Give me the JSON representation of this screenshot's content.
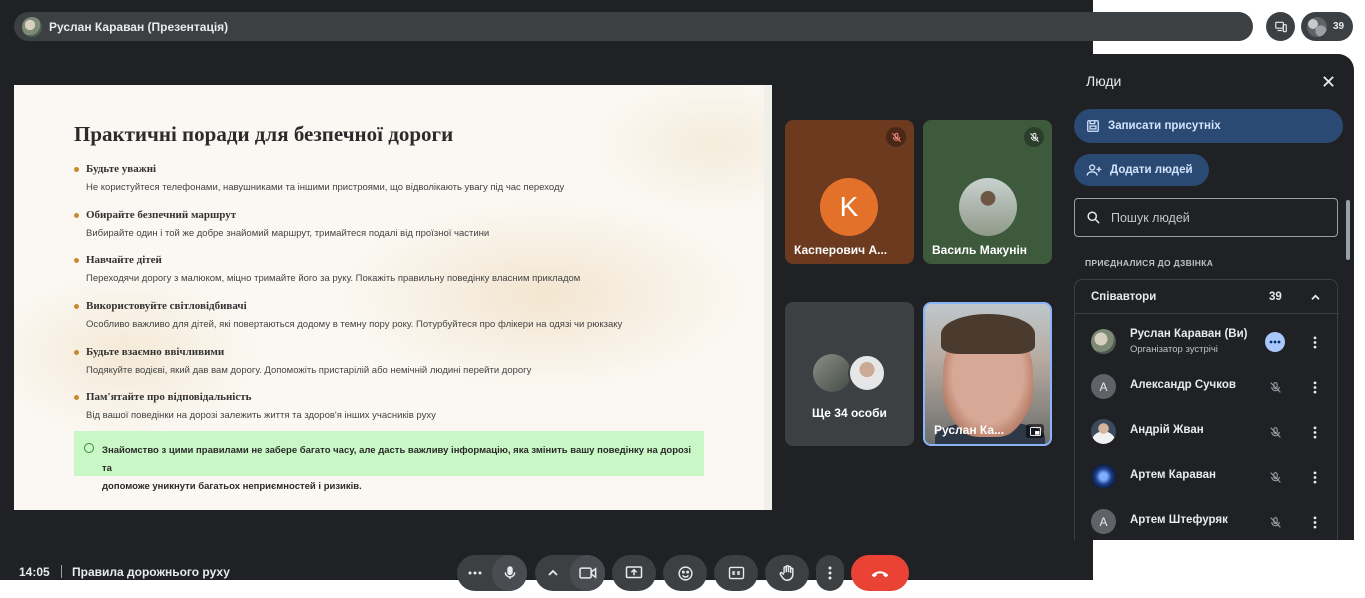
{
  "top_bar": {
    "presenter_title": "Руслан Караван (Презентація)",
    "participant_count": "39"
  },
  "slide": {
    "title": "Практичні поради для безпечної дороги",
    "tips": [
      {
        "heading": "Будьте уважні",
        "text": "Не користуйтеся телефонами, навушниками та іншими пристроями, що відволікають увагу під час переходу"
      },
      {
        "heading": "Обирайте безпечний маршрут",
        "text": "Вибирайте один і той же добре знайомий маршрут, тримайтеся подалі від проїзної частини"
      },
      {
        "heading": "Навчайте дітей",
        "text": "Переходячи дорогу з малюком, міцно тримайте його за руку. Покажіть правильну поведінку власним прикладом"
      },
      {
        "heading": "Використовуйте світловідбивачі",
        "text": "Особливо важливо для дітей, які повертаються додому в темну пору року. Потурбуйтеся про флікери на одязі чи рюкзаку"
      },
      {
        "heading": "Будьте взаємно ввічливими",
        "text": "Подякуйте водієві, який дав вам дорогу. Допоможіть пристарілій або немічній людині перейти дорогу"
      },
      {
        "heading": "Пам'ятайте про відповідальність",
        "text": "Від вашої поведінки на дорозі залежить життя та здоров'я інших учасників руху"
      }
    ],
    "note_line1": "Знайомство з цими правилами не забере багато часу, але дасть важливу інформацію, яка змінить вашу поведінку на дорозі та",
    "note_line2": "допоможе уникнути багатьох неприємностей і ризиків."
  },
  "tiles": {
    "tile1": {
      "initial": "K",
      "name": "Касперович А..."
    },
    "tile2": {
      "name": "Василь Макунін"
    },
    "more": {
      "label": "Ще 34 особи"
    },
    "self": {
      "name": "Руслан Ка..."
    }
  },
  "footer": {
    "time": "14:05",
    "meeting_name": "Правила дорожнього руху"
  },
  "panel": {
    "title": "Люди",
    "attendance_button": "Записати присутніх",
    "add_button": "Додати людей",
    "search_placeholder": "Пошук людей",
    "section_label": "ПРИЄДНАЛИСЯ ДО ДЗВІНКА",
    "group_label": "Співавтори",
    "group_count": "39",
    "people": [
      {
        "name": "Руслан Караван (Ви)",
        "role": "Організатор зустрічі"
      },
      {
        "name": "Александр Сучков",
        "initial": "А"
      },
      {
        "name": "Андрій Жван"
      },
      {
        "name": "Артем Караван"
      },
      {
        "name": "Артем Штефуряк",
        "initial": "А"
      }
    ]
  },
  "colors": {
    "accent": "#8ab4f8",
    "hangup": "#ea4335",
    "panel_button": "#2b4a73",
    "stage": "#202124"
  },
  "icons": [
    "devices-icon",
    "more-horizontal-icon",
    "mic-icon",
    "chevron-up-icon",
    "camera-icon",
    "present-icon",
    "emoji-icon",
    "captions-icon",
    "hand-icon",
    "more-vertical-icon",
    "call-end-icon",
    "close-icon",
    "attendance-icon",
    "person-add-icon",
    "search-icon",
    "mic-off-icon"
  ]
}
